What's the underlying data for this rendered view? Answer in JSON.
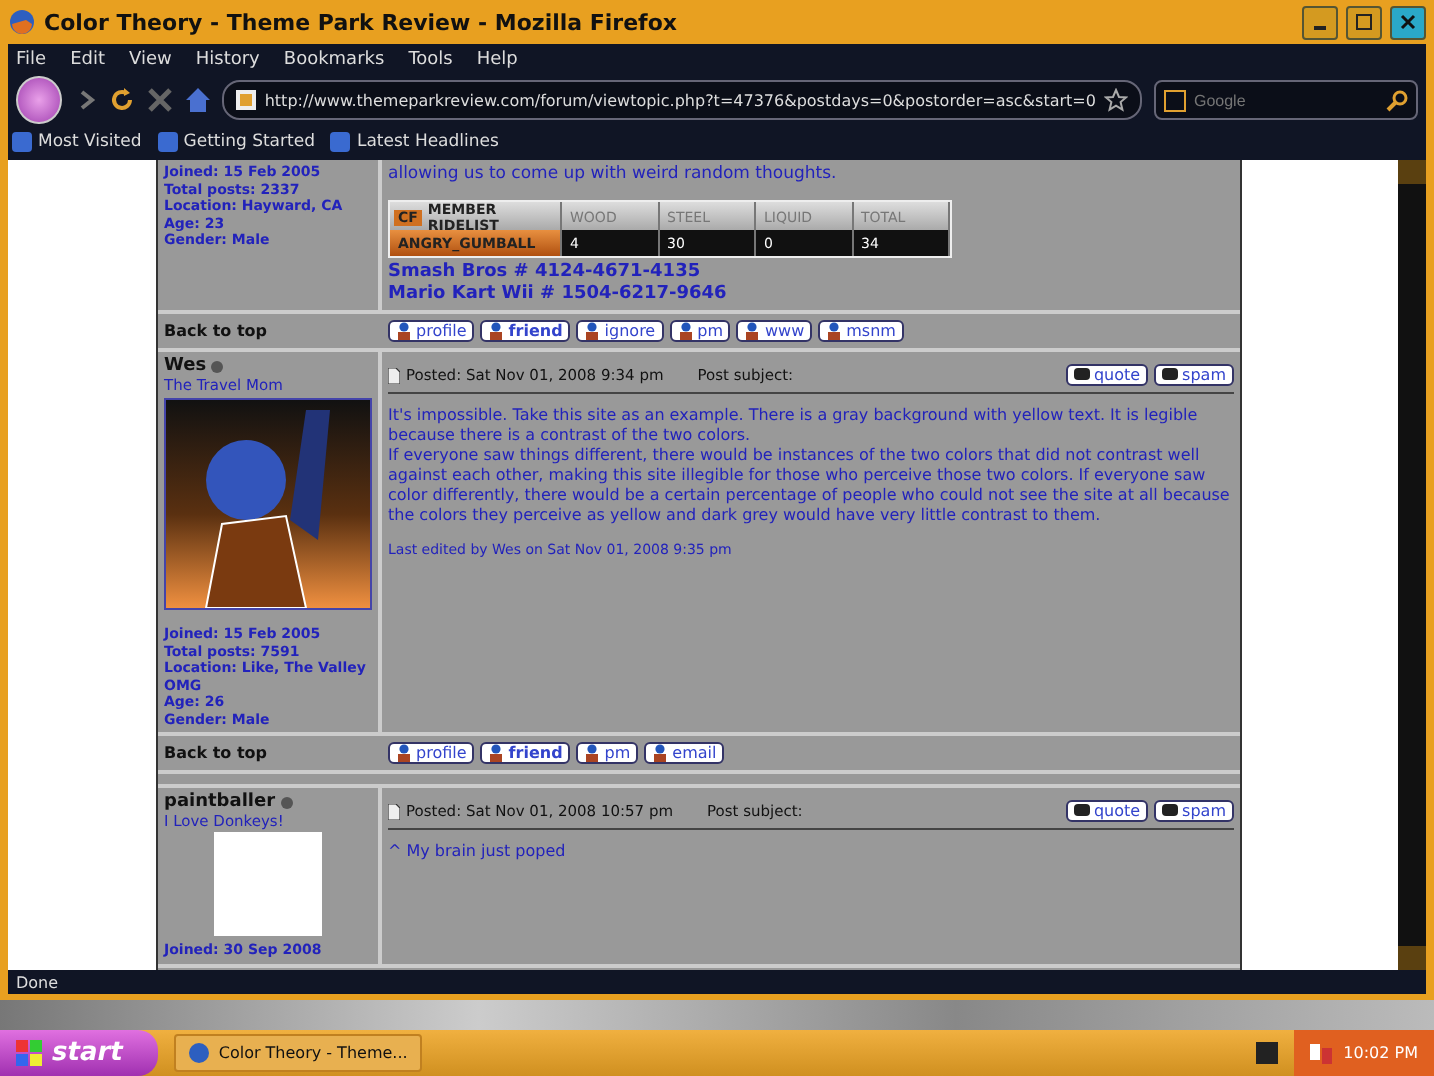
{
  "window": {
    "title": "Color Theory - Theme Park Review - Mozilla Firefox"
  },
  "menu": [
    "File",
    "Edit",
    "View",
    "History",
    "Bookmarks",
    "Tools",
    "Help"
  ],
  "navbar": {
    "url": "http://www.themeparkreview.com/forum/viewtopic.php?t=47376&postdays=0&postorder=asc&start=0",
    "search_placeholder": "Google"
  },
  "bookmarks": [
    "Most Visited",
    "Getting Started",
    "Latest Headlines"
  ],
  "previous_post": {
    "profile_lines": [
      "Joined: 15 Feb 2005",
      "Total posts: 2337",
      "Location: Hayward, CA",
      "Age: 23",
      "Gender: Male"
    ],
    "body_line": "allowing us to come up with weird random thoughts.",
    "ridelist": {
      "logo": "CF",
      "columns": [
        "MEMBER RIDELIST",
        "WOOD",
        "STEEL",
        "LIQUID",
        "TOTAL"
      ],
      "row": [
        "ANGRY_GUMBALL",
        "4",
        "30",
        "0",
        "34"
      ]
    },
    "signature": [
      "Smash Bros # 4124-4671-4135",
      "Mario Kart Wii # 1504-6217-9646"
    ],
    "back_to_top": "Back to top",
    "buttons": [
      "profile",
      "friend",
      "ignore",
      "pm",
      "www",
      "msnm"
    ]
  },
  "posts": [
    {
      "author": "Wes",
      "rank": "The Travel Mom",
      "avatar": {
        "kind": "drawing"
      },
      "posted": "Posted: Sat Nov 01, 2008 9:34 pm",
      "subject_label": "Post subject:",
      "actions": [
        "quote",
        "spam"
      ],
      "body": [
        "It's impossible. Take this site as an example. There is a gray background with yellow text. It is legible because there is a contrast of the two colors.",
        "If everyone saw things different, there would be instances of the two colors that did not contrast well against each other, making this site illegible for those who perceive those two colors. If everyone saw color differently, there would be a certain percentage of people who could not see the site at all because the colors they perceive as yellow and dark grey would have very little contrast to them."
      ],
      "edited": "Last edited by Wes on Sat Nov 01, 2008 9:35 pm",
      "profile_lines": [
        "Joined: 15 Feb 2005",
        "Total posts: 7591",
        "Location: Like, The Valley OMG",
        "Age: 26",
        "Gender: Male"
      ],
      "back_to_top": "Back to top",
      "buttons": [
        "profile",
        "friend",
        "pm",
        "email"
      ]
    },
    {
      "author": "paintballer",
      "rank": "I Love Donkeys!",
      "avatar": {
        "kind": "blank"
      },
      "posted": "Posted: Sat Nov 01, 2008 10:57 pm",
      "subject_label": "Post subject:",
      "actions": [
        "quote",
        "spam"
      ],
      "body": [
        "^ My brain just poped"
      ],
      "profile_lines": [
        "Joined: 30 Sep 2008"
      ]
    }
  ],
  "status_bar": "Done",
  "taskbar": {
    "start": "start",
    "task": "Color Theory - Theme...",
    "clock": "10:02 PM"
  }
}
